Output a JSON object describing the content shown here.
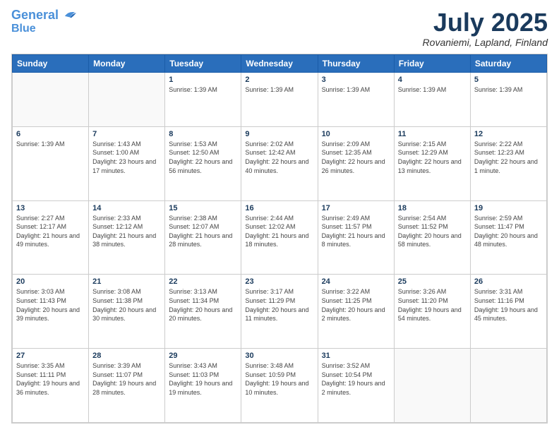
{
  "header": {
    "logo_line1": "General",
    "logo_line2": "Blue",
    "month": "July 2025",
    "location": "Rovaniemi, Lapland, Finland"
  },
  "weekdays": [
    "Sunday",
    "Monday",
    "Tuesday",
    "Wednesday",
    "Thursday",
    "Friday",
    "Saturday"
  ],
  "weeks": [
    [
      {
        "day": "",
        "info": ""
      },
      {
        "day": "",
        "info": ""
      },
      {
        "day": "1",
        "info": "Sunrise: 1:39 AM"
      },
      {
        "day": "2",
        "info": "Sunrise: 1:39 AM"
      },
      {
        "day": "3",
        "info": "Sunrise: 1:39 AM"
      },
      {
        "day": "4",
        "info": "Sunrise: 1:39 AM"
      },
      {
        "day": "5",
        "info": "Sunrise: 1:39 AM"
      }
    ],
    [
      {
        "day": "6",
        "info": "Sunrise: 1:39 AM"
      },
      {
        "day": "7",
        "info": "Sunrise: 1:43 AM\nSunset: 1:00 AM\nDaylight: 23 hours and 17 minutes."
      },
      {
        "day": "8",
        "info": "Sunrise: 1:53 AM\nSunset: 12:50 AM\nDaylight: 22 hours and 56 minutes."
      },
      {
        "day": "9",
        "info": "Sunrise: 2:02 AM\nSunset: 12:42 AM\nDaylight: 22 hours and 40 minutes."
      },
      {
        "day": "10",
        "info": "Sunrise: 2:09 AM\nSunset: 12:35 AM\nDaylight: 22 hours and 26 minutes."
      },
      {
        "day": "11",
        "info": "Sunrise: 2:15 AM\nSunset: 12:29 AM\nDaylight: 22 hours and 13 minutes."
      },
      {
        "day": "12",
        "info": "Sunrise: 2:22 AM\nSunset: 12:23 AM\nDaylight: 22 hours and 1 minute."
      }
    ],
    [
      {
        "day": "13",
        "info": "Sunrise: 2:27 AM\nSunset: 12:17 AM\nDaylight: 21 hours and 49 minutes."
      },
      {
        "day": "14",
        "info": "Sunrise: 2:33 AM\nSunset: 12:12 AM\nDaylight: 21 hours and 38 minutes."
      },
      {
        "day": "15",
        "info": "Sunrise: 2:38 AM\nSunset: 12:07 AM\nDaylight: 21 hours and 28 minutes."
      },
      {
        "day": "16",
        "info": "Sunrise: 2:44 AM\nSunset: 12:02 AM\nDaylight: 21 hours and 18 minutes."
      },
      {
        "day": "17",
        "info": "Sunrise: 2:49 AM\nSunset: 11:57 PM\nDaylight: 21 hours and 8 minutes."
      },
      {
        "day": "18",
        "info": "Sunrise: 2:54 AM\nSunset: 11:52 PM\nDaylight: 20 hours and 58 minutes."
      },
      {
        "day": "19",
        "info": "Sunrise: 2:59 AM\nSunset: 11:47 PM\nDaylight: 20 hours and 48 minutes."
      }
    ],
    [
      {
        "day": "20",
        "info": "Sunrise: 3:03 AM\nSunset: 11:43 PM\nDaylight: 20 hours and 39 minutes."
      },
      {
        "day": "21",
        "info": "Sunrise: 3:08 AM\nSunset: 11:38 PM\nDaylight: 20 hours and 30 minutes."
      },
      {
        "day": "22",
        "info": "Sunrise: 3:13 AM\nSunset: 11:34 PM\nDaylight: 20 hours and 20 minutes."
      },
      {
        "day": "23",
        "info": "Sunrise: 3:17 AM\nSunset: 11:29 PM\nDaylight: 20 hours and 11 minutes."
      },
      {
        "day": "24",
        "info": "Sunrise: 3:22 AM\nSunset: 11:25 PM\nDaylight: 20 hours and 2 minutes."
      },
      {
        "day": "25",
        "info": "Sunrise: 3:26 AM\nSunset: 11:20 PM\nDaylight: 19 hours and 54 minutes."
      },
      {
        "day": "26",
        "info": "Sunrise: 3:31 AM\nSunset: 11:16 PM\nDaylight: 19 hours and 45 minutes."
      }
    ],
    [
      {
        "day": "27",
        "info": "Sunrise: 3:35 AM\nSunset: 11:11 PM\nDaylight: 19 hours and 36 minutes."
      },
      {
        "day": "28",
        "info": "Sunrise: 3:39 AM\nSunset: 11:07 PM\nDaylight: 19 hours and 28 minutes."
      },
      {
        "day": "29",
        "info": "Sunrise: 3:43 AM\nSunset: 11:03 PM\nDaylight: 19 hours and 19 minutes."
      },
      {
        "day": "30",
        "info": "Sunrise: 3:48 AM\nSunset: 10:59 PM\nDaylight: 19 hours and 10 minutes."
      },
      {
        "day": "31",
        "info": "Sunrise: 3:52 AM\nSunset: 10:54 PM\nDaylight: 19 hours and 2 minutes."
      },
      {
        "day": "",
        "info": ""
      },
      {
        "day": "",
        "info": ""
      }
    ]
  ]
}
